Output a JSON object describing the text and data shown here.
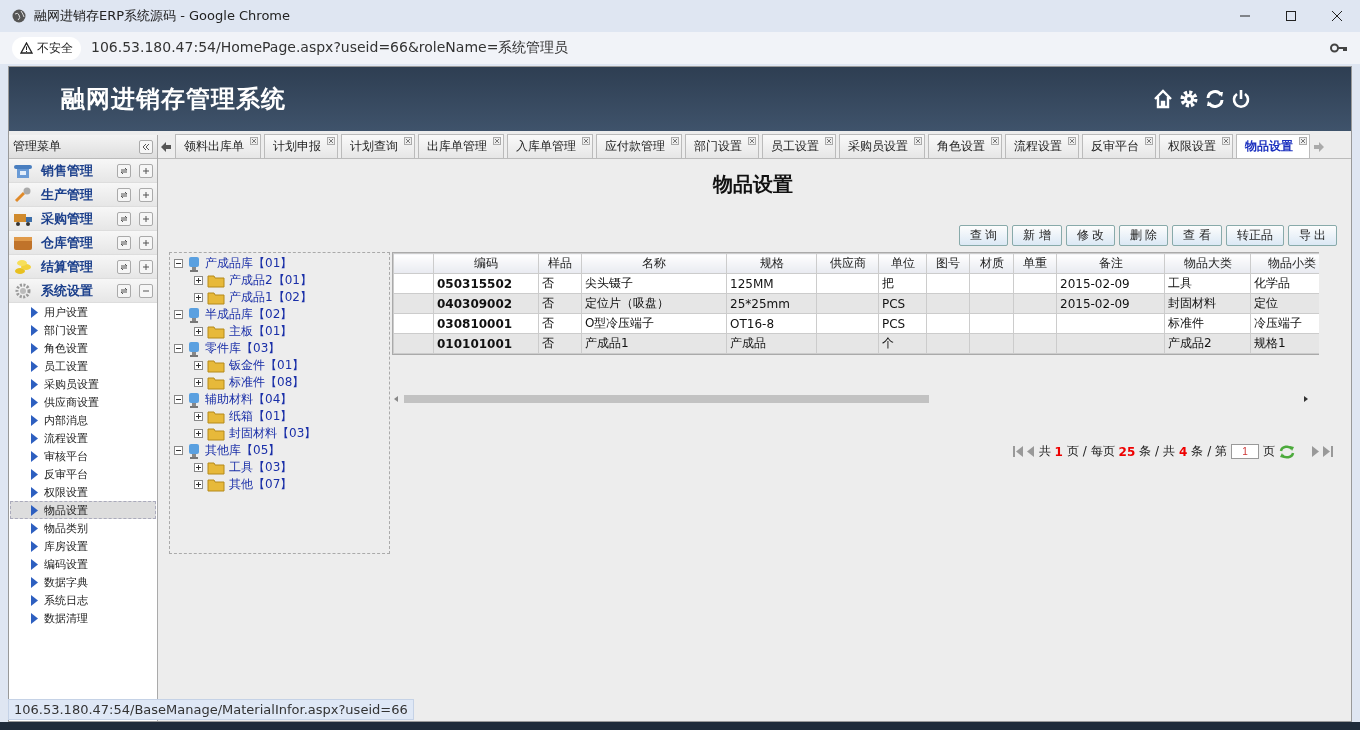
{
  "browser": {
    "title": "融网进销存ERP系统源码 - Google Chrome",
    "security": "不安全",
    "url": "106.53.180.47:54/HomePage.aspx?useid=66&roleName=系统管理员"
  },
  "app": {
    "title": "融网进销存管理系统"
  },
  "sidebar": {
    "title": "管理菜单",
    "groups": [
      {
        "label": "销售管理",
        "expanded": false
      },
      {
        "label": "生产管理",
        "expanded": false
      },
      {
        "label": "采购管理",
        "expanded": false
      },
      {
        "label": "仓库管理",
        "expanded": false
      },
      {
        "label": "结算管理",
        "expanded": false
      },
      {
        "label": "系统设置",
        "expanded": true,
        "items": [
          {
            "label": "用户设置",
            "selected": false
          },
          {
            "label": "部门设置",
            "selected": false
          },
          {
            "label": "角色设置",
            "selected": false
          },
          {
            "label": "员工设置",
            "selected": false
          },
          {
            "label": "采购员设置",
            "selected": false
          },
          {
            "label": "供应商设置",
            "selected": false
          },
          {
            "label": "内部消息",
            "selected": false
          },
          {
            "label": "流程设置",
            "selected": false
          },
          {
            "label": "审核平台",
            "selected": false
          },
          {
            "label": "反审平台",
            "selected": false
          },
          {
            "label": "权限设置",
            "selected": false
          },
          {
            "label": "物品设置",
            "selected": true
          },
          {
            "label": "物品类别",
            "selected": false
          },
          {
            "label": "库房设置",
            "selected": false
          },
          {
            "label": "编码设置",
            "selected": false
          },
          {
            "label": "数据字典",
            "selected": false
          },
          {
            "label": "系统日志",
            "selected": false
          },
          {
            "label": "数据清理",
            "selected": false
          }
        ]
      }
    ]
  },
  "tabs": [
    {
      "label": "领料出库单",
      "selected": false
    },
    {
      "label": "计划申报",
      "selected": false
    },
    {
      "label": "计划查询",
      "selected": false
    },
    {
      "label": "出库单管理",
      "selected": false
    },
    {
      "label": "入库单管理",
      "selected": false
    },
    {
      "label": "应付款管理",
      "selected": false
    },
    {
      "label": "部门设置",
      "selected": false
    },
    {
      "label": "员工设置",
      "selected": false
    },
    {
      "label": "采购员设置",
      "selected": false
    },
    {
      "label": "角色设置",
      "selected": false
    },
    {
      "label": "流程设置",
      "selected": false
    },
    {
      "label": "反审平台",
      "selected": false
    },
    {
      "label": "权限设置",
      "selected": false
    },
    {
      "label": "物品设置",
      "selected": true
    }
  ],
  "page": {
    "title": "物品设置",
    "buttons": [
      "查 询",
      "新 增",
      "修 改",
      "删 除",
      "查 看",
      "转正品",
      "导 出"
    ]
  },
  "tree": [
    {
      "label": "产成品库【01】",
      "expanded": true,
      "children": [
        {
          "label": "产成品2【01】",
          "expanded": false
        },
        {
          "label": "产成品1【02】",
          "expanded": false
        }
      ]
    },
    {
      "label": "半成品库【02】",
      "expanded": true,
      "children": [
        {
          "label": "主板【01】",
          "expanded": false
        }
      ]
    },
    {
      "label": "零件库【03】",
      "expanded": true,
      "children": [
        {
          "label": "钣金件【01】",
          "expanded": false
        },
        {
          "label": "标准件【08】",
          "expanded": false
        }
      ]
    },
    {
      "label": "辅助材料【04】",
      "expanded": true,
      "children": [
        {
          "label": "纸箱【01】",
          "expanded": false
        },
        {
          "label": "封固材料【03】",
          "expanded": false
        }
      ]
    },
    {
      "label": "其他库【05】",
      "expanded": true,
      "children": [
        {
          "label": "工具【03】",
          "expanded": false
        },
        {
          "label": "其他【07】",
          "expanded": false
        }
      ]
    }
  ],
  "table": {
    "columns": [
      "编码",
      "样品",
      "名称",
      "规格",
      "供应商",
      "单位",
      "图号",
      "材质",
      "单重",
      "备注",
      "物品大类",
      "物品小类"
    ],
    "rows": [
      [
        "050315502",
        "否",
        "尖头镊子",
        "125MM",
        "",
        "把",
        "",
        "",
        "",
        "2015-02-09",
        "工具",
        "化学品"
      ],
      [
        "040309002",
        "否",
        "定位片（吸盘）",
        "25*25mm",
        "",
        "PCS",
        "",
        "",
        "",
        "2015-02-09",
        "封固材料",
        "定位"
      ],
      [
        "030810001",
        "否",
        "O型冷压端子",
        "OT16-8",
        "",
        "PCS",
        "",
        "",
        "",
        "",
        "标准件",
        "冷压端子"
      ],
      [
        "010101001",
        "否",
        "产成品1",
        "产成品",
        "",
        "个",
        "",
        "",
        "",
        "",
        "产成品2",
        "规格1"
      ]
    ]
  },
  "pager": {
    "parts": [
      {
        "text": "共",
        "highlight": false
      },
      {
        "text": "1",
        "highlight": true
      },
      {
        "text": "页 / 每页",
        "highlight": false
      },
      {
        "text": "25",
        "highlight": true
      },
      {
        "text": "条 / 共",
        "highlight": false
      },
      {
        "text": "4",
        "highlight": true
      },
      {
        "text": "条 / 第",
        "highlight": false
      }
    ],
    "page_value": "1",
    "suffix": "页"
  },
  "status_url": "106.53.180.47:54/BaseManage/MaterialInfor.aspx?useid=66"
}
